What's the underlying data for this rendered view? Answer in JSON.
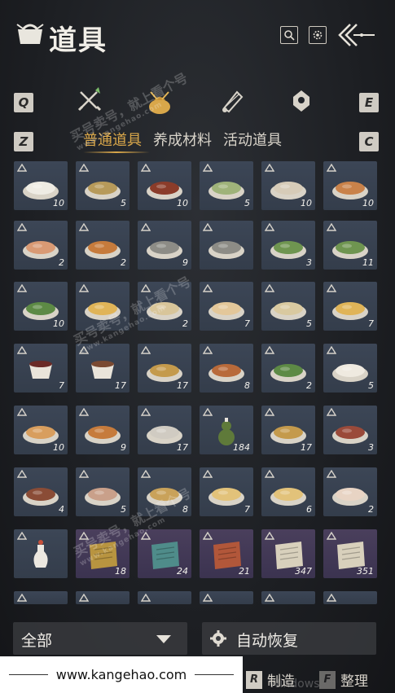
{
  "header": {
    "title": "道具"
  },
  "category_keys": {
    "left": "Q",
    "right": "E"
  },
  "sub_keys": {
    "left": "Z",
    "right": "C"
  },
  "categories": [
    {
      "icon": "crossed-swords-icon",
      "active": false
    },
    {
      "icon": "pouch-icon",
      "active": true
    },
    {
      "icon": "scroll-icon",
      "active": false
    },
    {
      "icon": "location-pin-icon",
      "active": false
    }
  ],
  "sub_tabs": [
    "普通道具",
    "养成材料",
    "活动道具"
  ],
  "items": [
    [
      {
        "qty": "10",
        "kind": "tofu"
      },
      {
        "qty": "5",
        "kind": "noodle"
      },
      {
        "qty": "10",
        "kind": "soup-red"
      },
      {
        "qty": "5",
        "kind": "veg-plate"
      },
      {
        "qty": "10",
        "kind": "fish-plate"
      },
      {
        "qty": "10",
        "kind": "cake"
      }
    ],
    [
      {
        "qty": "2",
        "kind": "fish-fillet"
      },
      {
        "qty": "2",
        "kind": "stew"
      },
      {
        "qty": "9",
        "kind": "oyster"
      },
      {
        "qty": "",
        "kind": "oyster"
      },
      {
        "qty": "3",
        "kind": "greens-bowl"
      },
      {
        "qty": "11",
        "kind": "greens-bowl"
      }
    ],
    [
      {
        "qty": "10",
        "kind": "greens-plate"
      },
      {
        "qty": "",
        "kind": "egg-bowl"
      },
      {
        "qty": "2",
        "kind": "pancake"
      },
      {
        "qty": "7",
        "kind": "bun"
      },
      {
        "qty": "5",
        "kind": "porridge"
      },
      {
        "qty": "7",
        "kind": "egg-bowl"
      }
    ],
    [
      {
        "qty": "7",
        "kind": "wine-bowl"
      },
      {
        "qty": "17",
        "kind": "cup"
      },
      {
        "qty": "17",
        "kind": "fried"
      },
      {
        "qty": "8",
        "kind": "chicken"
      },
      {
        "qty": "2",
        "kind": "greens-plate"
      },
      {
        "qty": "5",
        "kind": "dumplings"
      }
    ],
    [
      {
        "qty": "10",
        "kind": "noodle-soup"
      },
      {
        "qty": "9",
        "kind": "stew"
      },
      {
        "qty": "17",
        "kind": "rice"
      },
      {
        "qty": "184",
        "kind": "gourd"
      },
      {
        "qty": "17",
        "kind": "fried"
      },
      {
        "qty": "3",
        "kind": "meat-bowl"
      }
    ],
    [
      {
        "qty": "4",
        "kind": "pot"
      },
      {
        "qty": "5",
        "kind": "pork"
      },
      {
        "qty": "8",
        "kind": "pot-soup"
      },
      {
        "qty": "7",
        "kind": "flatbread"
      },
      {
        "qty": "6",
        "kind": "flatbread"
      },
      {
        "qty": "2",
        "kind": "steamed-bun"
      }
    ],
    [
      {
        "qty": "",
        "kind": "vase"
      },
      {
        "qty": "18",
        "kind": "paper-gold"
      },
      {
        "qty": "24",
        "kind": "paper-teal"
      },
      {
        "qty": "21",
        "kind": "paper-red"
      },
      {
        "qty": "347",
        "kind": "letter"
      },
      {
        "qty": "351",
        "kind": "letter"
      }
    ]
  ],
  "filter": {
    "label": "全部"
  },
  "auto_restore": {
    "label": "自动恢复"
  },
  "actions": [
    {
      "key": "R",
      "label": "制造"
    },
    {
      "key": "F",
      "label": "整理"
    }
  ],
  "watermark": {
    "text": "买号卖号，就上看个号",
    "url": "www.kangehao.com"
  },
  "footer": {
    "url": "www.kangehao.com"
  },
  "system_overlay": {
    "text": "Windows"
  }
}
